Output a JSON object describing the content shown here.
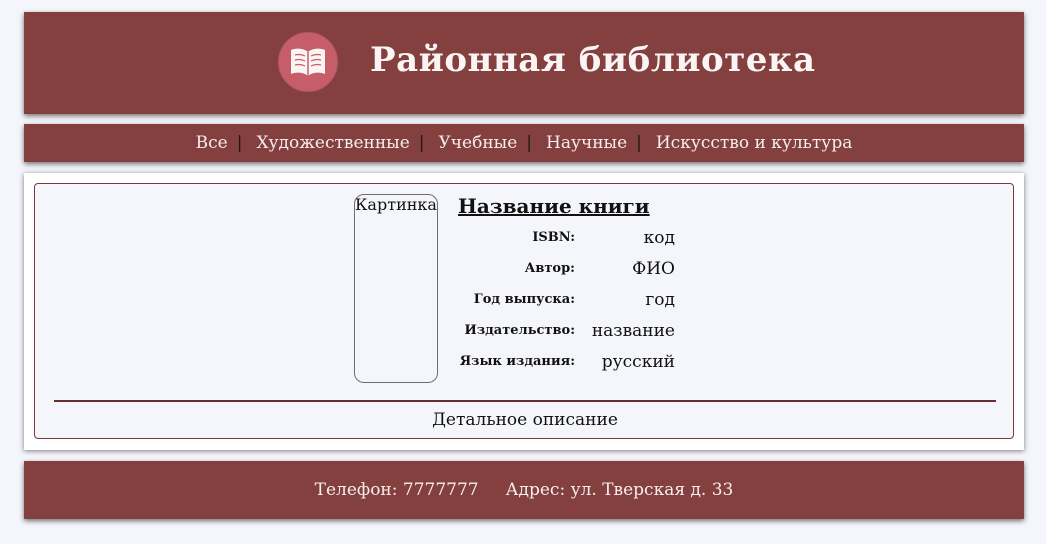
{
  "header": {
    "title": "Районная библиотека",
    "logo_icon": "open-book-icon"
  },
  "nav": {
    "items": [
      {
        "label": "Все"
      },
      {
        "label": "Художественные"
      },
      {
        "label": "Учебные"
      },
      {
        "label": "Научные"
      },
      {
        "label": "Искусство и культура"
      }
    ],
    "separator": "|"
  },
  "book": {
    "cover_label": "Картинка",
    "title": "Название книги",
    "fields": [
      {
        "label": "ISBN:",
        "value": "код"
      },
      {
        "label": "Автор:",
        "value": "ФИО"
      },
      {
        "label": "Год выпуска:",
        "value": "год"
      },
      {
        "label": "Издательство:",
        "value": "название"
      },
      {
        "label": "Язык издания:",
        "value": "русский"
      }
    ],
    "details_link": "Детальное описание"
  },
  "footer": {
    "phone_label": "Телефон:",
    "phone": "7777777",
    "address_label": "Адрес:",
    "address": "ул. Тверская д. 33"
  },
  "colors": {
    "brand": "#843f3f",
    "logo": "#c65e69",
    "page_bg": "#f5f6fb"
  }
}
